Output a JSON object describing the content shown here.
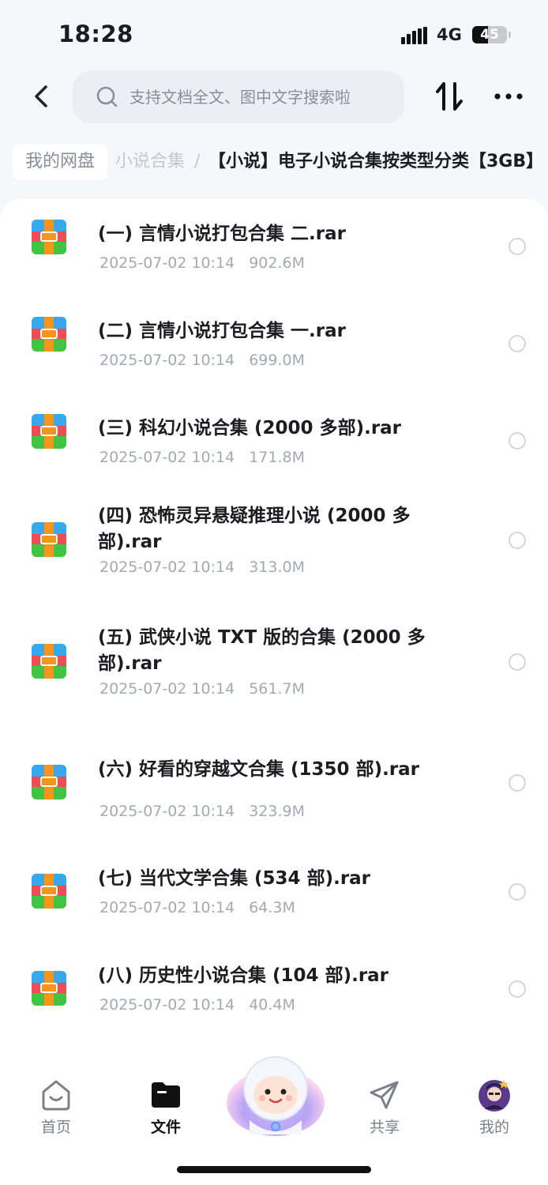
{
  "status_bar": {
    "time": "18:28",
    "network": "4G",
    "battery": "45"
  },
  "header": {
    "search_placeholder": "支持文档全文、图中文字搜索啦"
  },
  "breadcrumb": {
    "home": "我的网盘",
    "parent": "小说合集",
    "separator": "/",
    "current": "【小说】电子小说合集按类型分类【3GB】"
  },
  "files": [
    {
      "name": "(一) 言情小说打包合集 二.rar",
      "date": "2025-07-02 10:14",
      "size": "902.6M"
    },
    {
      "name": "(二) 言情小说打包合集 一.rar",
      "date": "2025-07-02 10:14",
      "size": "699.0M"
    },
    {
      "name": "(三) 科幻小说合集 (2000 多部).rar",
      "date": "2025-07-02 10:14",
      "size": "171.8M"
    },
    {
      "name": "(四) 恐怖灵异悬疑推理小说 (2000 多部).rar",
      "date": "2025-07-02 10:14",
      "size": "313.0M"
    },
    {
      "name": "(五) 武侠小说 TXT 版的合集 (2000 多部).rar",
      "date": "2025-07-02 10:14",
      "size": "561.7M"
    },
    {
      "name": "(六) 好看的穿越文合集 (1350 部).rar",
      "date": "2025-07-02 10:14",
      "size": "323.9M"
    },
    {
      "name": "(七) 当代文学合集 (534 部).rar",
      "date": "2025-07-02 10:14",
      "size": "64.3M"
    },
    {
      "name": "(八) 历史性小说合集 (104 部).rar",
      "date": "2025-07-02 10:14",
      "size": "40.4M"
    }
  ],
  "file_icon": "archive-icon",
  "tabs": [
    {
      "label": "首页",
      "icon": "home-icon"
    },
    {
      "label": "文件",
      "icon": "folder-icon",
      "active": true
    },
    {
      "label": "共享",
      "icon": "send-icon"
    },
    {
      "label": "我的",
      "icon": "avatar"
    }
  ],
  "colors": {
    "accent_dark": "#111111",
    "muted": "#a5a8b3"
  }
}
